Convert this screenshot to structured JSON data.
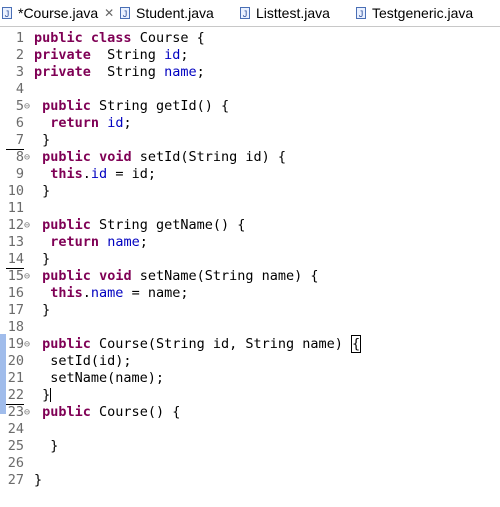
{
  "tabs": [
    {
      "label": "*Course.java",
      "active": true,
      "closable": true
    },
    {
      "label": "Student.java"
    },
    {
      "label": "Listtest.java"
    },
    {
      "label": "Testgeneric.java"
    }
  ],
  "lines": [
    {
      "n": "1",
      "t": [
        [
          "kw",
          "public"
        ],
        [
          "p",
          " "
        ],
        [
          "kw",
          "class"
        ],
        [
          "p",
          " Course {"
        ]
      ]
    },
    {
      "n": "2",
      "t": [
        [
          "kw",
          "private"
        ],
        [
          "p",
          "  String "
        ],
        [
          "fld",
          "id"
        ],
        [
          "p",
          ";"
        ]
      ]
    },
    {
      "n": "3",
      "t": [
        [
          "kw",
          "private"
        ],
        [
          "p",
          "  String "
        ],
        [
          "fld",
          "name"
        ],
        [
          "p",
          ";"
        ]
      ]
    },
    {
      "n": "4",
      "t": []
    },
    {
      "n": "5",
      "fold": true,
      "t": [
        [
          "p",
          " "
        ],
        [
          "kw",
          "public"
        ],
        [
          "p",
          " String getId() {"
        ]
      ]
    },
    {
      "n": "6",
      "t": [
        [
          "p",
          "  "
        ],
        [
          "kw",
          "return"
        ],
        [
          "p",
          " "
        ],
        [
          "fld",
          "id"
        ],
        [
          "p",
          ";"
        ]
      ]
    },
    {
      "n": "7",
      "u": true,
      "t": [
        [
          "p",
          " }"
        ]
      ]
    },
    {
      "n": "8",
      "fold": true,
      "t": [
        [
          "p",
          " "
        ],
        [
          "kw",
          "public"
        ],
        [
          "p",
          " "
        ],
        [
          "kw",
          "void"
        ],
        [
          "p",
          " setId(String id) {"
        ]
      ]
    },
    {
      "n": "9",
      "t": [
        [
          "p",
          "  "
        ],
        [
          "kw",
          "this"
        ],
        [
          "p",
          "."
        ],
        [
          "fld",
          "id"
        ],
        [
          "p",
          " = id;"
        ]
      ]
    },
    {
      "n": "10",
      "t": [
        [
          "p",
          " }"
        ]
      ]
    },
    {
      "n": "11",
      "t": []
    },
    {
      "n": "12",
      "fold": true,
      "t": [
        [
          "p",
          " "
        ],
        [
          "kw",
          "public"
        ],
        [
          "p",
          " String getName() {"
        ]
      ]
    },
    {
      "n": "13",
      "t": [
        [
          "p",
          "  "
        ],
        [
          "kw",
          "return"
        ],
        [
          "p",
          " "
        ],
        [
          "fld",
          "name"
        ],
        [
          "p",
          ";"
        ]
      ]
    },
    {
      "n": "14",
      "u": true,
      "t": [
        [
          "p",
          " }"
        ]
      ]
    },
    {
      "n": "15",
      "fold": true,
      "t": [
        [
          "p",
          " "
        ],
        [
          "kw",
          "public"
        ],
        [
          "p",
          " "
        ],
        [
          "kw",
          "void"
        ],
        [
          "p",
          " setName(String name) {"
        ]
      ]
    },
    {
      "n": "16",
      "t": [
        [
          "p",
          "  "
        ],
        [
          "kw",
          "this"
        ],
        [
          "p",
          "."
        ],
        [
          "fld",
          "name"
        ],
        [
          "p",
          " = name;"
        ]
      ]
    },
    {
      "n": "17",
      "t": [
        [
          "p",
          " }"
        ]
      ]
    },
    {
      "n": "18",
      "t": []
    },
    {
      "n": "19",
      "fold": true,
      "t": [
        [
          "p",
          " "
        ],
        [
          "kw",
          "public"
        ],
        [
          "p",
          " Course(String id, String name) "
        ],
        [
          "box",
          "{"
        ]
      ]
    },
    {
      "n": "20",
      "t": [
        [
          "p",
          "  setId(id);"
        ]
      ]
    },
    {
      "n": "21",
      "t": [
        [
          "p",
          "  setName(name);"
        ]
      ]
    },
    {
      "n": "22",
      "u": true,
      "t": [
        [
          "p",
          " }"
        ],
        [
          "caret",
          ""
        ]
      ]
    },
    {
      "n": "23",
      "fold": true,
      "t": [
        [
          "p",
          " "
        ],
        [
          "kw",
          "public"
        ],
        [
          "p",
          " Course() {"
        ]
      ]
    },
    {
      "n": "24",
      "t": []
    },
    {
      "n": "25",
      "t": [
        [
          "p",
          "  }"
        ]
      ]
    },
    {
      "n": "26",
      "t": []
    },
    {
      "n": "27",
      "t": [
        [
          "p",
          "}"
        ]
      ]
    }
  ]
}
